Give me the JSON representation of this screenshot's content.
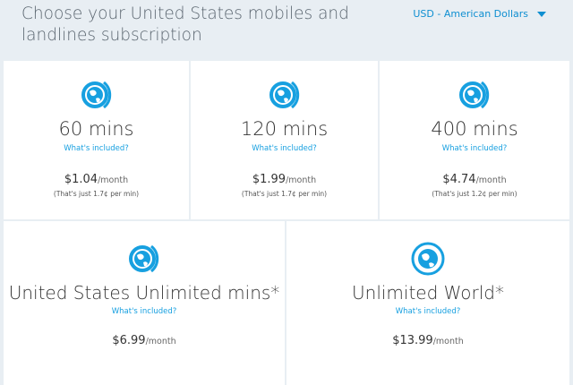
{
  "header": {
    "title": "Choose your United States mobiles and landlines subscription",
    "currency": "USD - American Dollars"
  },
  "plans": [
    {
      "mins": "60 mins",
      "included": "What's included?",
      "price": "$1.04",
      "per": "/month",
      "note": "(That's just 1.7¢ per min)"
    },
    {
      "mins": "120 mins",
      "included": "What's included?",
      "price": "$1.99",
      "per": "/month",
      "note": "(That's just 1.7¢ per min)"
    },
    {
      "mins": "400 mins",
      "included": "What's included?",
      "price": "$4.74",
      "per": "/month",
      "note": "(That's just 1.2¢ per min)"
    },
    {
      "mins": "United States Unlimited mins*",
      "included": "What's included?",
      "price": "$6.99",
      "per": "/month"
    },
    {
      "mins": "Unlimited World*",
      "included": "What's included?",
      "price": "$13.99",
      "per": "/month"
    }
  ],
  "colors": {
    "accent": "#17a0e0",
    "background": "#e8eef3"
  },
  "icons": {
    "plan": "globe-icon",
    "dropdown": "chevron-down-icon"
  }
}
